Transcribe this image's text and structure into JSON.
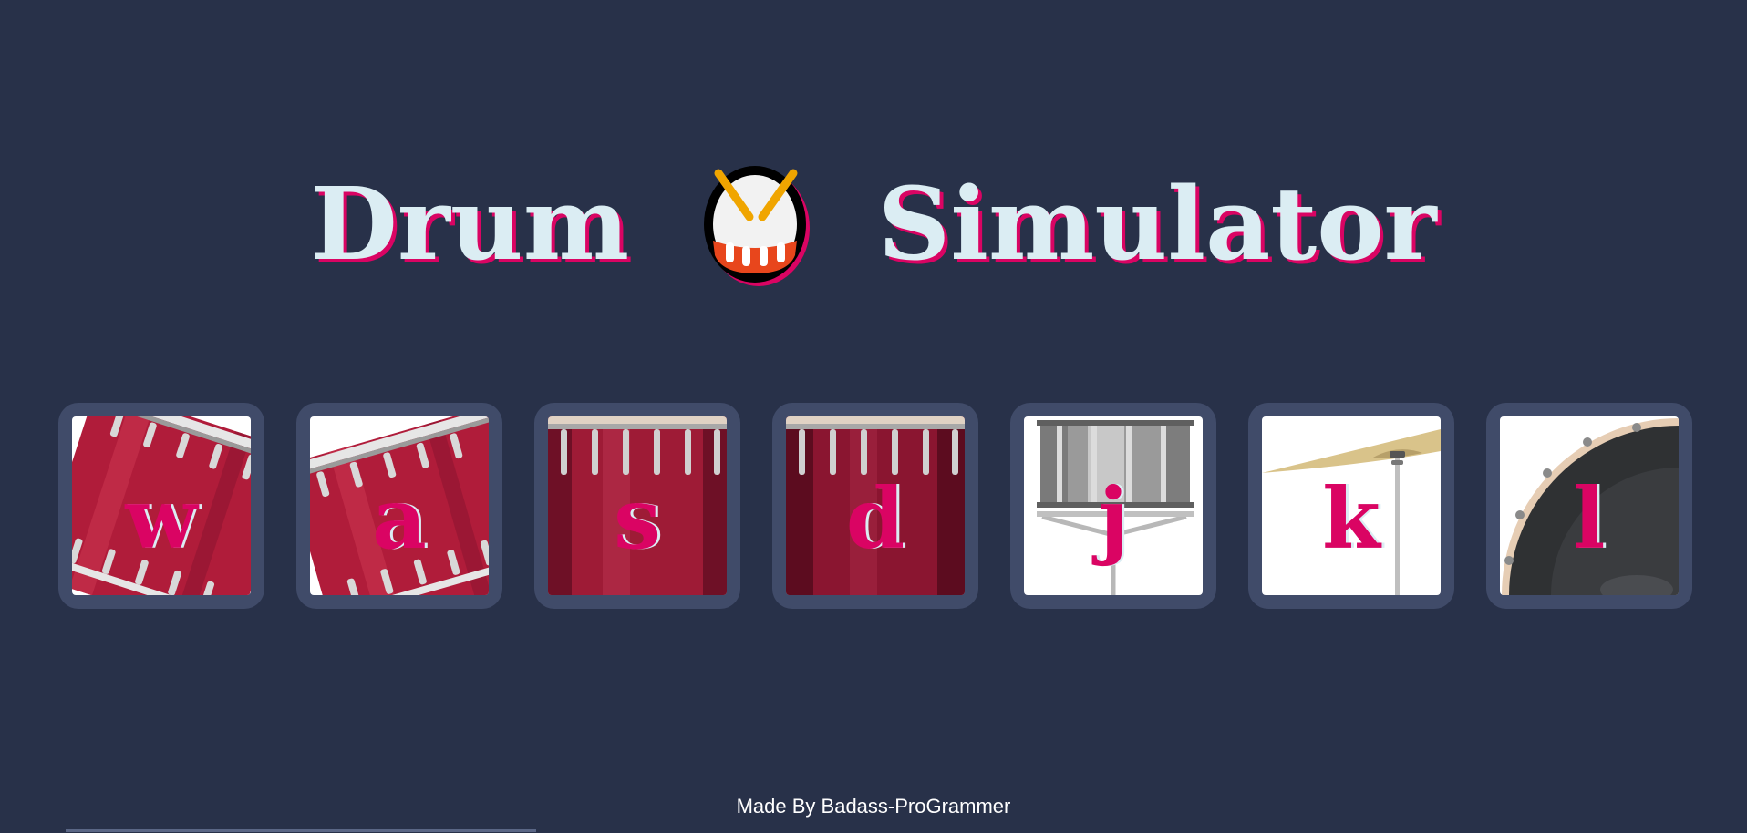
{
  "header": {
    "title_left": "Drum",
    "title_icon": "drum-emoji-icon",
    "title_right": "Simulator"
  },
  "drums": [
    {
      "key": "w",
      "icon": "tom-drum-icon"
    },
    {
      "key": "a",
      "icon": "tom-drum-icon"
    },
    {
      "key": "s",
      "icon": "floor-tom-icon"
    },
    {
      "key": "d",
      "icon": "floor-tom-icon"
    },
    {
      "key": "j",
      "icon": "snare-drum-icon"
    },
    {
      "key": "k",
      "icon": "cymbal-icon"
    },
    {
      "key": "l",
      "icon": "bass-drum-icon"
    }
  ],
  "footer": {
    "credit": "Made By Badass-ProGrammer"
  },
  "colors": {
    "background": "#283149",
    "drum_frame": "#404b69",
    "title_text": "#dbedf3",
    "accent": "#da0463"
  }
}
